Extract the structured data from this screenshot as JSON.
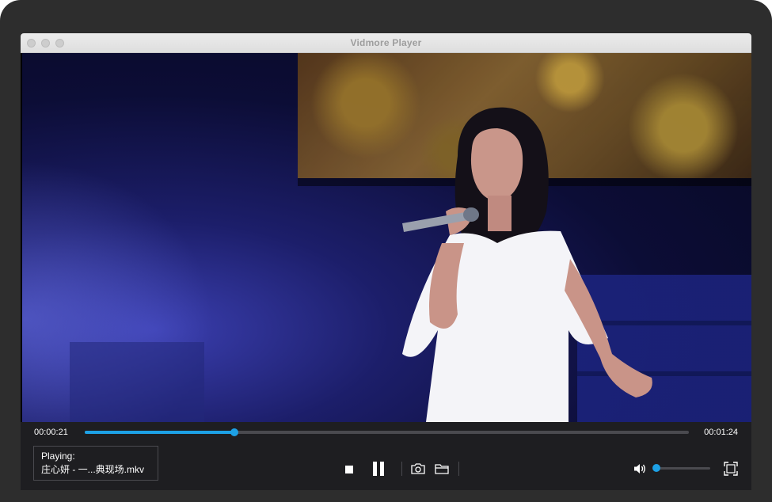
{
  "window": {
    "title": "Vidmore Player"
  },
  "player": {
    "current_time": "00:00:21",
    "total_time": "00:01:24",
    "progress_fraction": 0.248,
    "volume_fraction": 0.0,
    "now_playing_label": "Playing:",
    "now_playing_file": "庄心妍 - 一...典现场.mkv"
  },
  "icons": {
    "stop": "stop-icon",
    "pause": "pause-icon",
    "snapshot": "camera-icon",
    "open": "folder-icon",
    "volume": "speaker-icon",
    "fullscreen": "fullscreen-icon"
  },
  "colors": {
    "accent": "#1da1e6",
    "control_bar": "#1e1e21"
  }
}
